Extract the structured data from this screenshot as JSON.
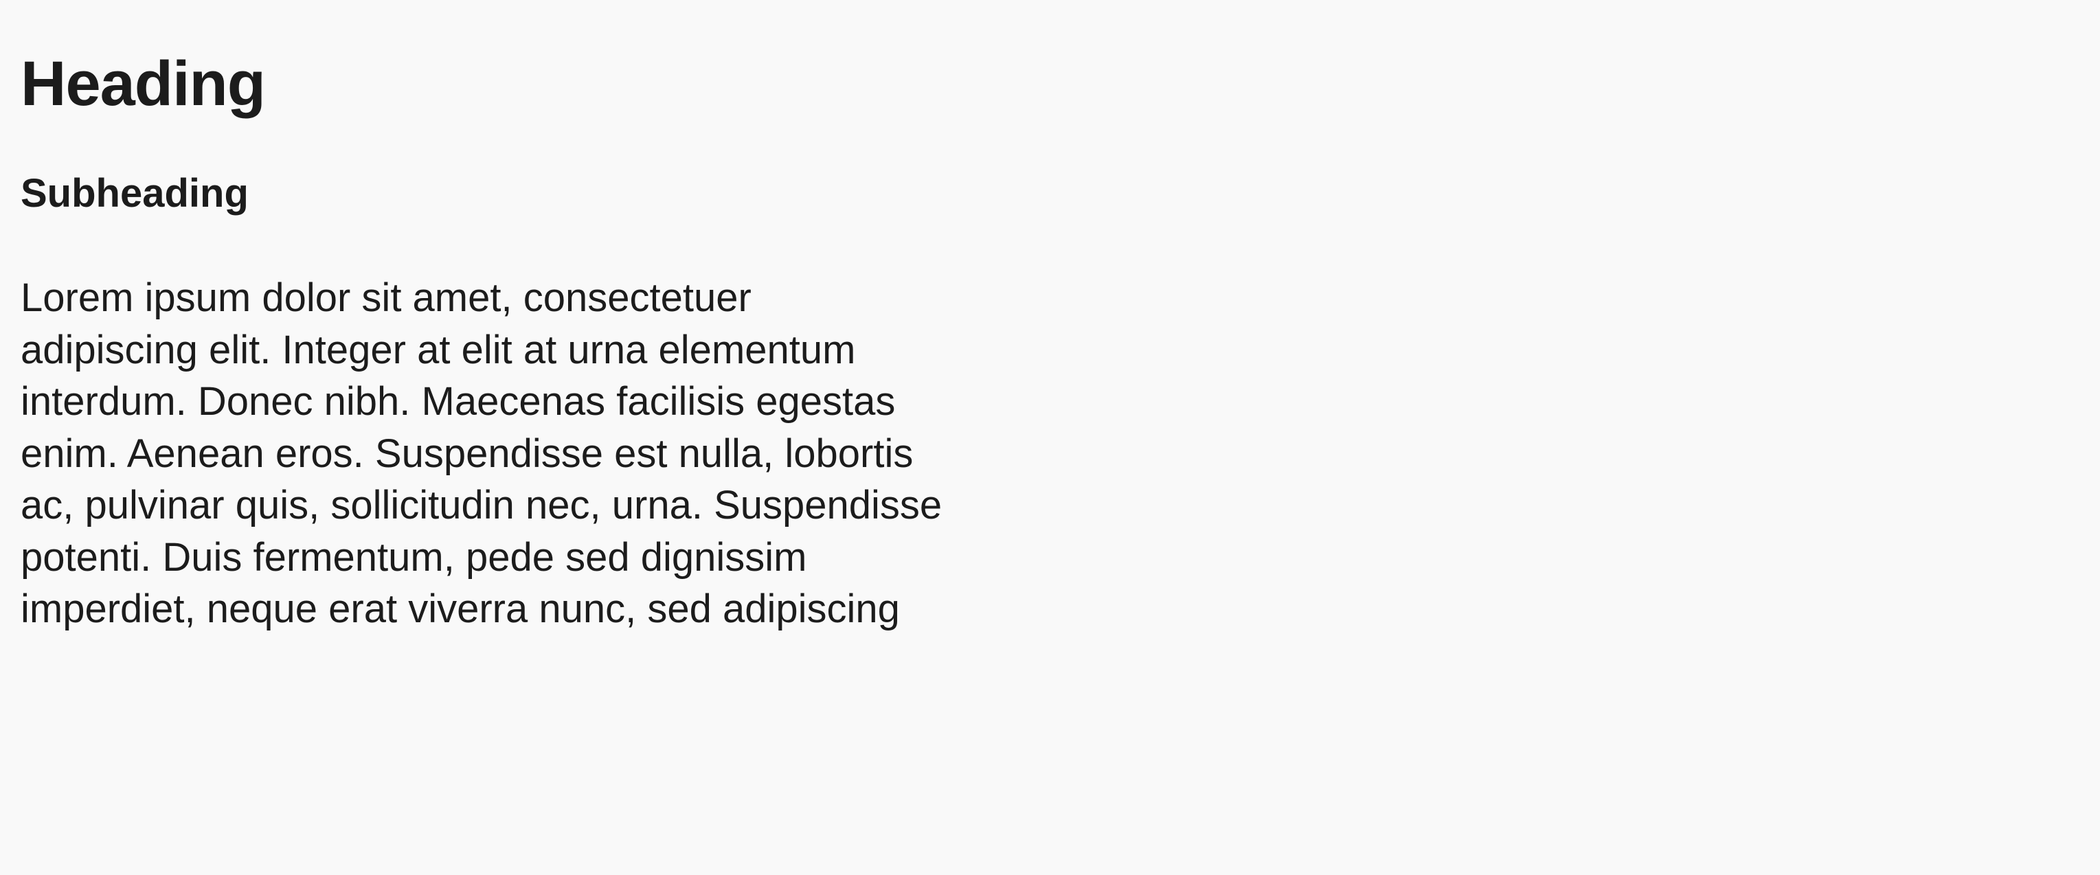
{
  "document": {
    "heading": "Heading",
    "subheading": "Subheading",
    "paragraph_lines": [
      "Lorem ipsum dolor sit amet, consectetuer",
      "adipiscing elit. Integer at elit at urna elementum",
      "interdum. Donec nibh. Maecenas facilisis egestas",
      "enim. Aenean eros. Suspendisse est nulla, lobortis",
      "ac, pulvinar quis, sollicitudin nec, urna. Suspendisse",
      "potenti. Duis fermentum, pede sed dignissim",
      "imperdiet, neque erat viverra nunc, sed adipiscing"
    ]
  },
  "colors": {
    "background": "#f9f9f9",
    "text": "#1c1c1c"
  }
}
